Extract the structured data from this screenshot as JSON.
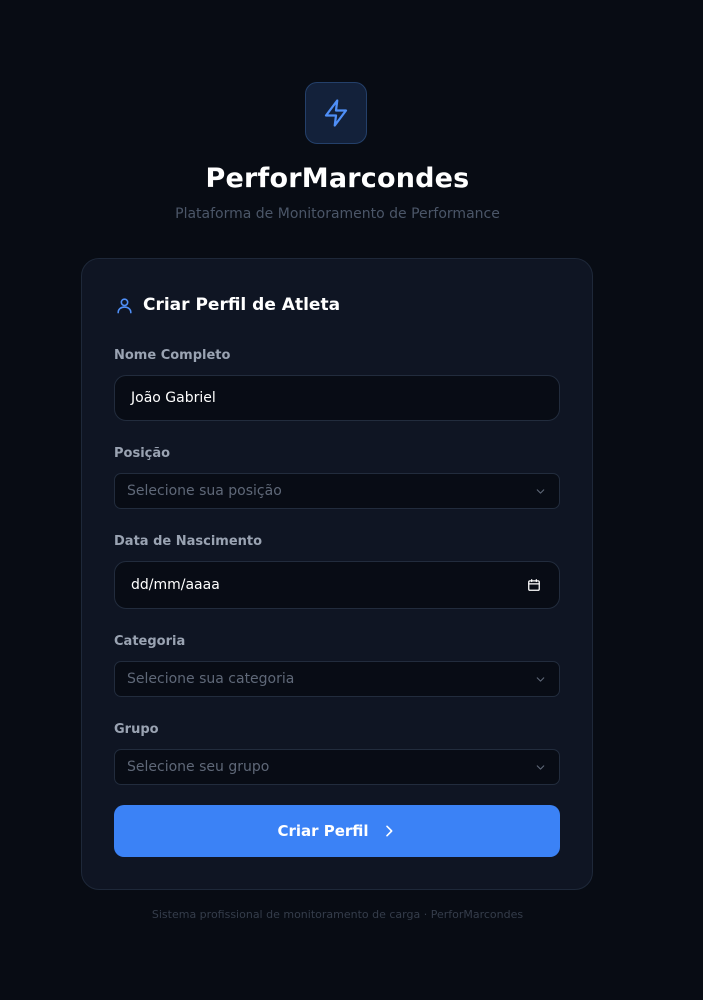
{
  "header": {
    "logo_icon": "lightning-bolt-icon",
    "brand": "PerforMarcondes",
    "tagline": "Plataforma de Monitoramento de Performance"
  },
  "card": {
    "title_icon": "user-icon",
    "title": "Criar Perfil de Atleta",
    "fields": {
      "name": {
        "label": "Nome Completo",
        "value": "João Gabriel"
      },
      "position": {
        "label": "Posição",
        "placeholder": "Selecione sua posição"
      },
      "birthdate": {
        "label": "Data de Nascimento",
        "placeholder": "dd/mm/aaaa"
      },
      "category": {
        "label": "Categoria",
        "placeholder": "Selecione sua categoria"
      },
      "group": {
        "label": "Grupo",
        "placeholder": "Selecione seu grupo"
      }
    },
    "submit_label": "Criar Perfil"
  },
  "footer": {
    "text": "Sistema profissional de monitoramento de carga · PerforMarcondes"
  },
  "colors": {
    "background": "#080c14",
    "card": "#0f1523",
    "accent": "#3b82f6"
  }
}
